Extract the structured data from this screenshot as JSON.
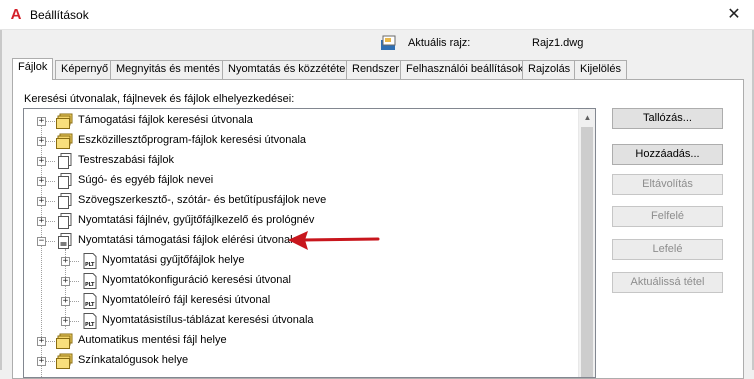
{
  "window": {
    "title": "Beállítások",
    "app_icon_glyph": "A",
    "close_glyph": "✕"
  },
  "current_drawing": {
    "label": "Aktuális rajz:",
    "value": "Rajz1.dwg",
    "icon": "drawing-file-icon"
  },
  "tabs": [
    {
      "label": "Fájlok",
      "active": true
    },
    {
      "label": "Képernyő",
      "active": false
    },
    {
      "label": "Megnyitás és mentés",
      "active": false
    },
    {
      "label": "Nyomtatás és közzététel",
      "active": false
    },
    {
      "label": "Rendszer",
      "active": false
    },
    {
      "label": "Felhasználói beállítások",
      "active": false
    },
    {
      "label": "Rajzolás",
      "active": false
    },
    {
      "label": "Kijelölés",
      "active": false
    }
  ],
  "panel": {
    "label": "Keresési útvonalak, fájlnevek és fájlok elhelyezkedései:"
  },
  "tree": {
    "items": [
      {
        "label": "Támogatási fájlok keresési útvonala",
        "icon": "folder-stack-icon",
        "expander": "+"
      },
      {
        "label": "Eszközillesztőprogram-fájlok keresési útvonala",
        "icon": "folder-stack-icon",
        "expander": "+"
      },
      {
        "label": "Testreszabási fájlok",
        "icon": "document-stack-icon",
        "expander": "+"
      },
      {
        "label": "Súgó- és egyéb fájlok nevei",
        "icon": "document-stack-icon",
        "expander": "+"
      },
      {
        "label": "Szövegszerkesztő-, szótár- és betűtípusfájlok neve",
        "icon": "document-stack-icon",
        "expander": "+"
      },
      {
        "label": "Nyomtatási fájlnév, gyűjtőfájlkezelő és prológnév",
        "icon": "document-stack-icon",
        "expander": "+"
      },
      {
        "label": "Nyomtatási támogatási fájlok elérési útvonala",
        "icon": "printer-document-icon",
        "expander": "−"
      },
      {
        "label": "Nyomtatási gyűjtőfájlok helye",
        "icon": "plt-file-icon",
        "expander": "+",
        "child": true
      },
      {
        "label": "Nyomtatókonfiguráció keresési útvonal",
        "icon": "plt-file-icon",
        "expander": "+",
        "child": true
      },
      {
        "label": "Nyomtatóleíró fájl keresési útvonal",
        "icon": "plt-file-icon",
        "expander": "+",
        "child": true
      },
      {
        "label": "Nyomtatásistílus-táblázat keresési útvonala",
        "icon": "plt-file-icon",
        "expander": "+",
        "child": true
      },
      {
        "label": "Automatikus mentési fájl helye",
        "icon": "folder-stack-icon",
        "expander": "+"
      },
      {
        "label": "Színkatalógusok helye",
        "icon": "folder-stack-icon",
        "expander": "+"
      }
    ],
    "plt_text": "PLT"
  },
  "buttons": {
    "browse": "Tallózás...",
    "add": "Hozzáadás...",
    "remove": "Eltávolítás",
    "up": "Felfelé",
    "down": "Lefelé",
    "set_current": "Aktuálissá tétel"
  },
  "colors": {
    "arrow": "#c8161d",
    "app_icon": "#d4202a",
    "folder": "#f5d66b"
  }
}
